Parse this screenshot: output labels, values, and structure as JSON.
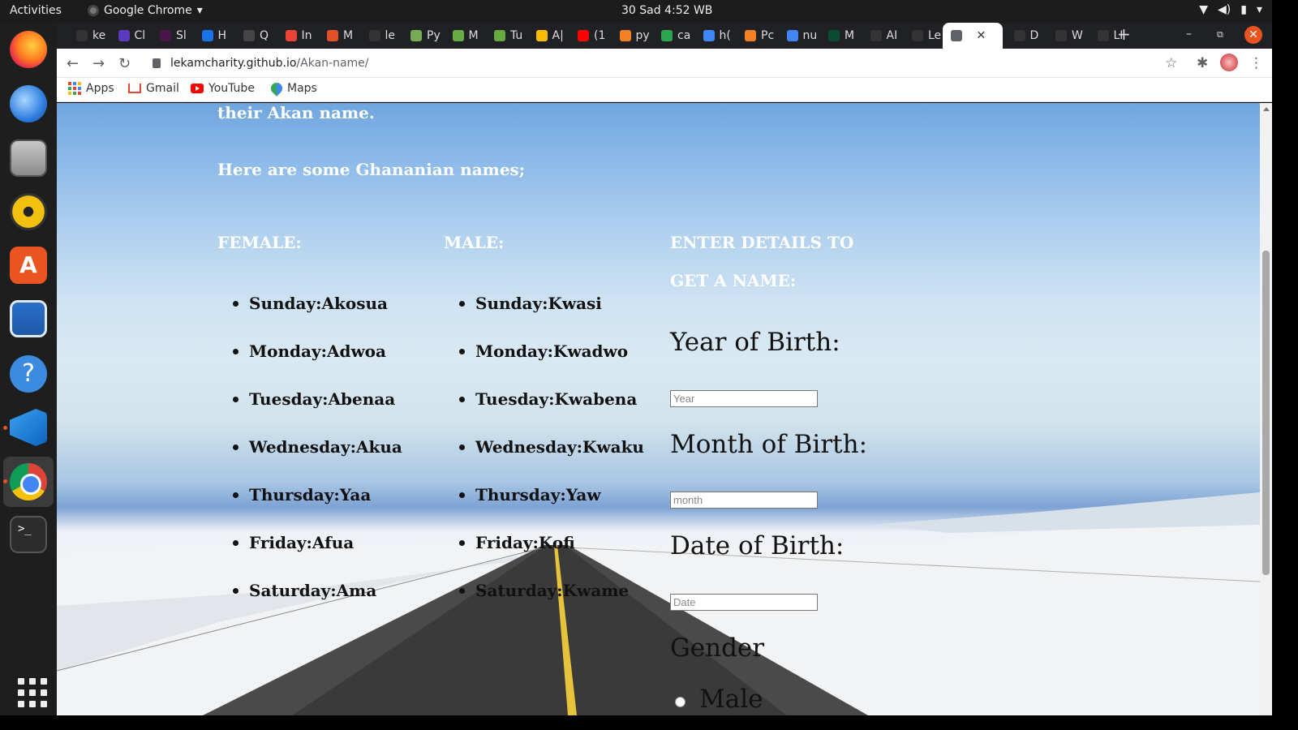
{
  "system": {
    "activities": "Activities",
    "app_name": "Google Chrome",
    "clock": "30 Sad  4:52 WB"
  },
  "browser": {
    "tabs": [
      "ke",
      "Cl",
      "Sl",
      "H",
      "Q",
      "In",
      "M",
      "le",
      "Py",
      "M",
      "Tu",
      "A|",
      "(1",
      "py",
      "ca",
      "h(",
      "Pc",
      "nu",
      "M",
      "AI",
      "Le",
      "",
      "D",
      "W",
      "LI"
    ],
    "new_tab": "+",
    "url_host": "lekamcharity.github.io",
    "url_path": "/Akan-name/",
    "bookmarks": [
      "Apps",
      "Gmail",
      "YouTube",
      "Maps"
    ]
  },
  "page": {
    "intro_tail": "their Akan name.",
    "names_intro": "Here are some Ghananian names;",
    "female_heading": "FEMALE:",
    "male_heading": "MALE:",
    "female_names": [
      "Sunday:Akosua",
      "Monday:Adwoa",
      "Tuesday:Abenaa",
      "Wednesday:Akua",
      "Thursday:Yaa",
      "Friday:Afua",
      "Saturday:Ama"
    ],
    "male_names": [
      "Sunday:Kwasi",
      "Monday:Kwadwo",
      "Tuesday:Kwabena",
      "Wednesday:Kwaku",
      "Thursday:Yaw",
      "Friday:Kofi",
      "Saturday:Kwame"
    ],
    "form_heading_line1": "ENTER DETAILS TO",
    "form_heading_line2": "GET A NAME:",
    "year_label": "Year of Birth:",
    "year_placeholder": "Year",
    "month_label": "Month of Birth:",
    "month_placeholder": "month",
    "date_label": "Date of Birth:",
    "date_placeholder": "Date",
    "gender_label": "Gender",
    "male_option": "Male"
  }
}
